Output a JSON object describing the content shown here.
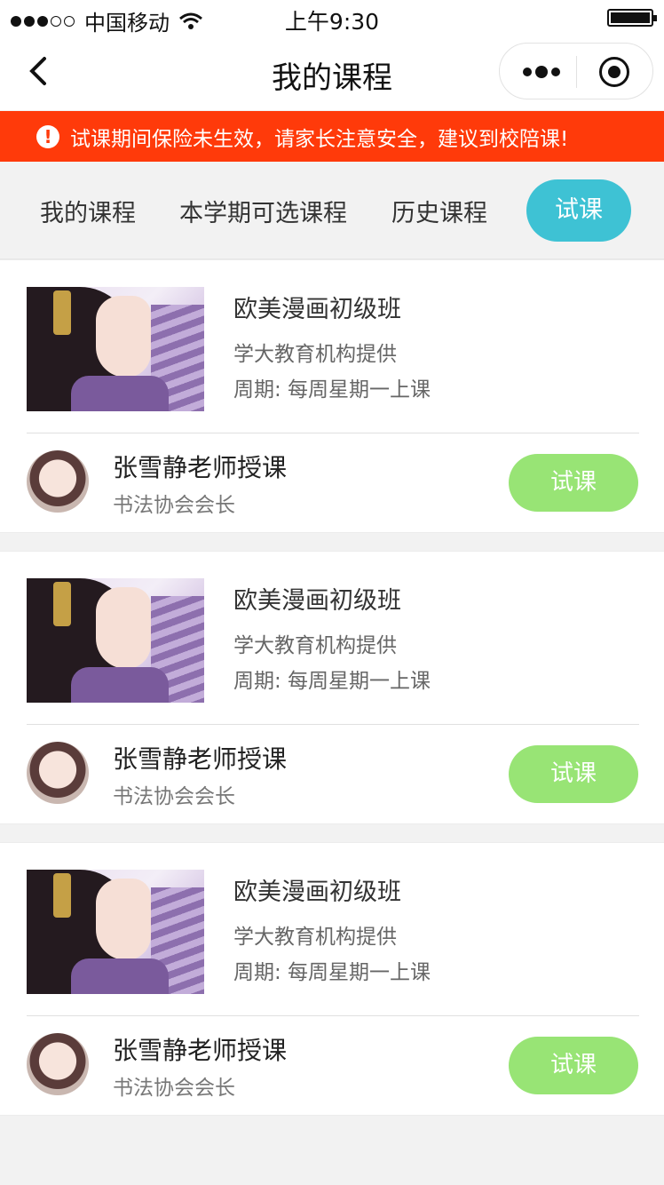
{
  "status_bar": {
    "carrier": "中国移动",
    "time": "上午9:30"
  },
  "nav": {
    "title": "我的课程"
  },
  "notice": {
    "text": "试课期间保险未生效，请家长注意安全，建议到校陪课!"
  },
  "tabs": [
    {
      "label": "我的课程",
      "active": false
    },
    {
      "label": "本学期可选课程",
      "active": false
    },
    {
      "label": "历史课程",
      "active": false
    },
    {
      "label": "试课",
      "active": true
    }
  ],
  "courses": [
    {
      "title": "欧美漫画初级班",
      "org": "学大教育机构提供",
      "period": "周期: 每周星期一上课",
      "teacher": "张雪静老师授课",
      "teacher_title": "书法协会会长",
      "button": "试课"
    },
    {
      "title": "欧美漫画初级班",
      "org": "学大教育机构提供",
      "period": "周期: 每周星期一上课",
      "teacher": "张雪静老师授课",
      "teacher_title": "书法协会会长",
      "button": "试课"
    },
    {
      "title": "欧美漫画初级班",
      "org": "学大教育机构提供",
      "period": "周期: 每周星期一上课",
      "teacher": "张雪静老师授课",
      "teacher_title": "书法协会会长",
      "button": "试课"
    }
  ],
  "colors": {
    "notice_bg": "#ff3a0a",
    "active_tab": "#3ec2d4",
    "trial_button": "#98e475"
  }
}
